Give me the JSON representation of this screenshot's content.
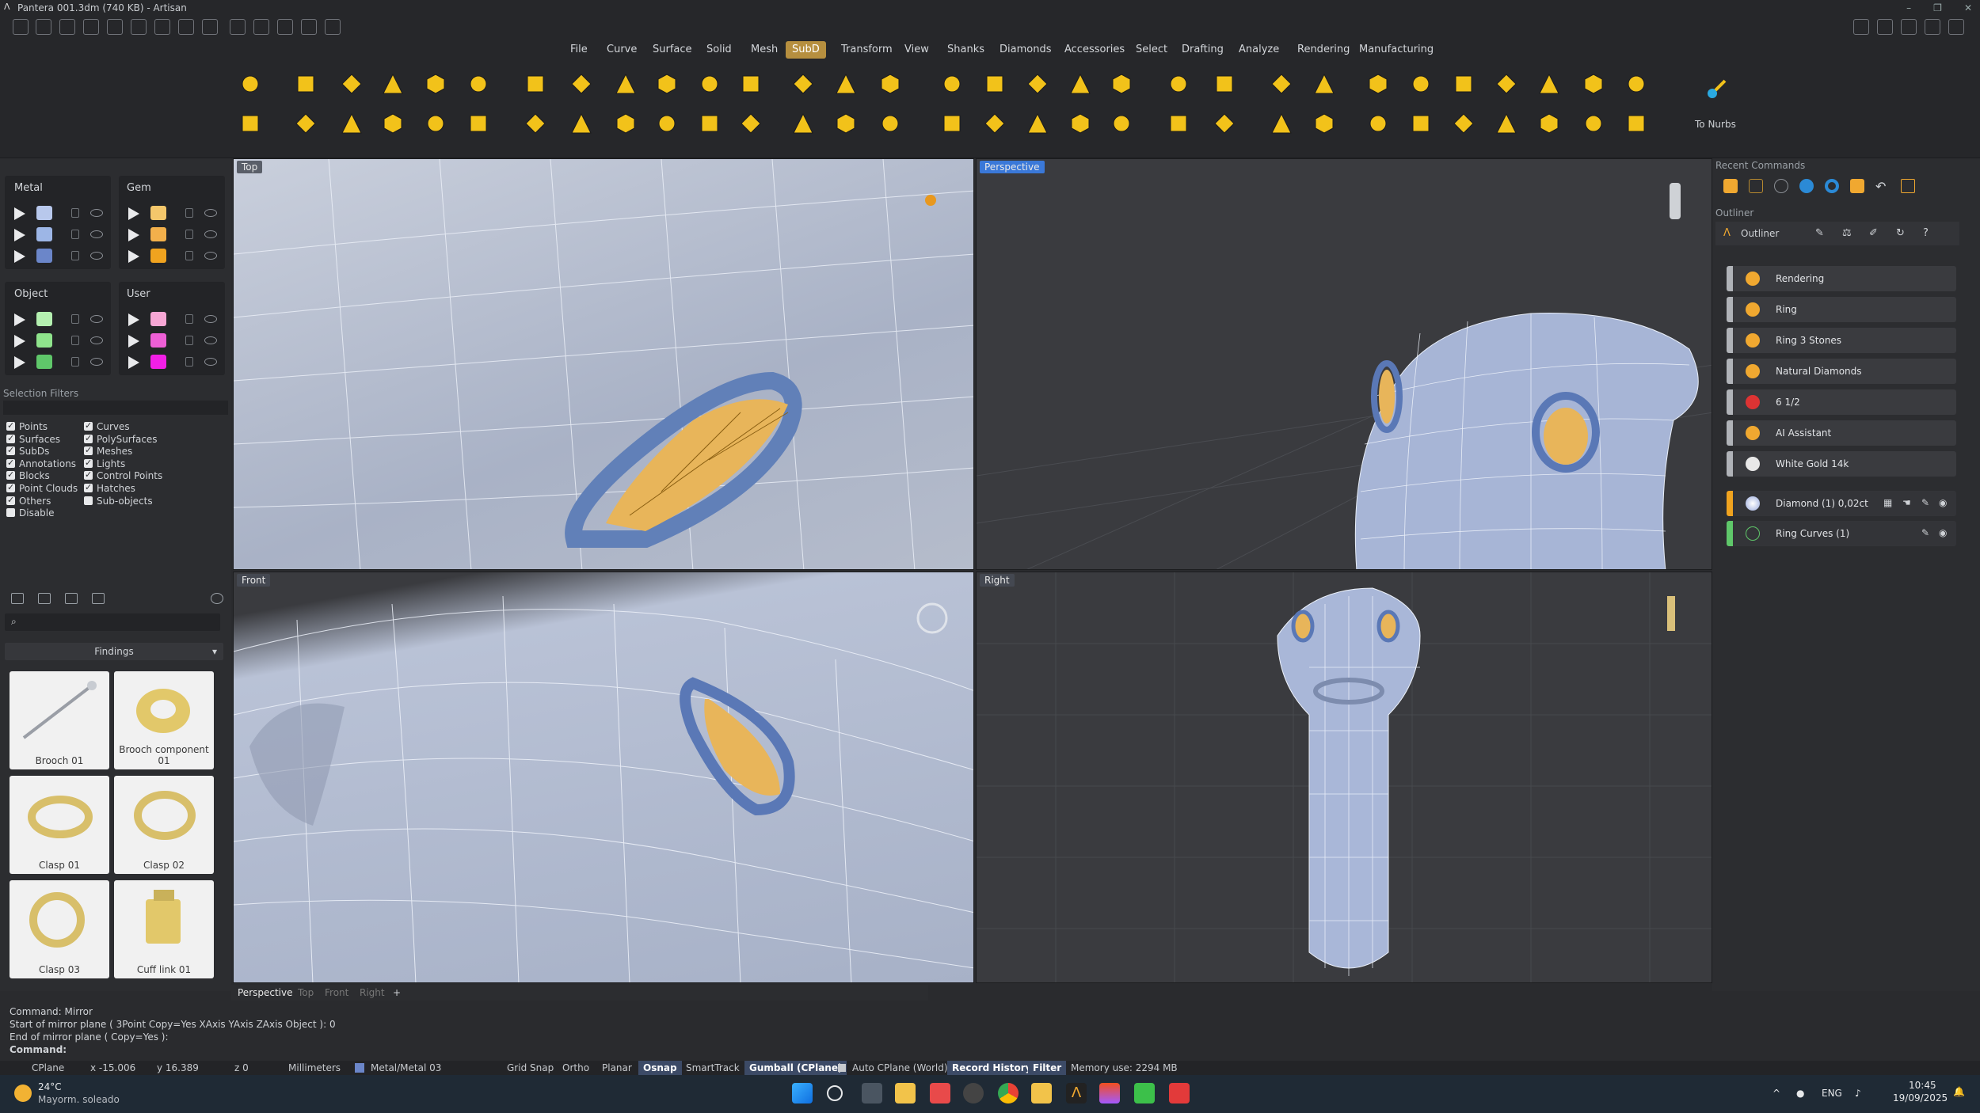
{
  "window": {
    "title": "Pantera 001.3dm (740 KB) - Artisan",
    "controls": [
      "–",
      "❐",
      "✕"
    ]
  },
  "menu": {
    "items": [
      "File",
      "Curve",
      "Surface",
      "Solid",
      "Mesh",
      "SubD",
      "Transform",
      "View",
      "Shanks",
      "Diamonds",
      "Accessories",
      "Select",
      "Drafting",
      "Analyze",
      "Rendering",
      "Manufacturing"
    ],
    "active": "SubD"
  },
  "ribbon": {
    "to_nurbs": "To Nurbs"
  },
  "layers": {
    "metal": {
      "title": "Metal",
      "colors": [
        "#b8c8ec",
        "#9db6e6",
        "#6b86c9"
      ]
    },
    "gem": {
      "title": "Gem",
      "colors": [
        "#f4c76b",
        "#f3b04b",
        "#f0a31f"
      ]
    },
    "object": {
      "title": "Object",
      "colors": [
        "#b4f0b0",
        "#8fe48c",
        "#5fc76a"
      ]
    },
    "user": {
      "title": "User",
      "colors": [
        "#f6a6d4",
        "#ee5fd6",
        "#f21fe6"
      ]
    }
  },
  "selection_filters": {
    "title": "Selection Filters",
    "left": [
      "Points",
      "Surfaces",
      "SubDs",
      "Annotations",
      "Blocks",
      "Point Clouds",
      "Others",
      "Disable"
    ],
    "right": [
      "Curves",
      "PolySurfaces",
      "Meshes",
      "Lights",
      "Control Points",
      "Hatches",
      "Sub-objects"
    ],
    "checked_left": [
      true,
      true,
      true,
      true,
      true,
      true,
      true,
      false
    ],
    "checked_right": [
      true,
      true,
      true,
      true,
      true,
      true,
      false
    ]
  },
  "library": {
    "search_placeholder": "",
    "category": "Findings",
    "items": [
      "Brooch 01",
      "Brooch component 01",
      "Clasp 01",
      "Clasp 02",
      "Clasp 03",
      "Cuff link 01"
    ]
  },
  "viewports": {
    "top": "Top",
    "perspective": "Perspective",
    "front": "Front",
    "right": "Right"
  },
  "viewport_tabs": [
    "Perspective",
    "Top",
    "Front",
    "Right",
    "+"
  ],
  "recent_commands": {
    "title": "Recent Commands"
  },
  "outliner": {
    "title": "Outliner",
    "header": "Outliner",
    "rows": [
      {
        "label": "Rendering",
        "color": "#b0b3b8",
        "icon_color": "#f0a830"
      },
      {
        "label": "Ring",
        "color": "#b0b3b8",
        "icon_color": "#f0a830"
      },
      {
        "label": "Ring 3 Stones",
        "color": "#b0b3b8",
        "icon_color": "#f0a830"
      },
      {
        "label": "Natural Diamonds",
        "color": "#b0b3b8",
        "icon_color": "#f0a830"
      },
      {
        "label": "6 1/2",
        "color": "#b0b3b8",
        "icon_color": "#d33"
      },
      {
        "label": "AI Assistant",
        "color": "#b0b3b8",
        "icon_color": "#f0a830"
      },
      {
        "label": "White Gold 14k",
        "color": "#b0b3b8",
        "icon_color": "#e8e8e8"
      }
    ],
    "objects": [
      {
        "label": "Diamond (1) 0,02ct",
        "color": "#f0a31f"
      },
      {
        "label": "Ring Curves (1)",
        "color": "#5fc76a"
      }
    ]
  },
  "command_history": [
    "Command: Mirror",
    "Start of mirror plane ( 3Point  Copy=Yes  XAxis  YAxis  ZAxis  Object ): 0",
    "End of mirror plane ( Copy=Yes ):"
  ],
  "command_prompt": "Command:",
  "status": {
    "cplane": "CPlane",
    "x": "x -15.006",
    "y": "y 16.389",
    "z": "z 0",
    "units": "Millimeters",
    "layer": "Metal/Metal 03",
    "grid_snap": "Grid Snap",
    "ortho": "Ortho",
    "planar": "Planar",
    "osnap": "Osnap",
    "smarttrack": "SmartTrack",
    "gumball": "Gumball (CPlane)",
    "auto_cplane": "Auto CPlane (World)",
    "record_history": "Record History",
    "filter": "Filter",
    "memory": "Memory use: 2294 MB"
  },
  "taskbar": {
    "temp": "24°C",
    "weather": "Mayorm. soleado",
    "lang": "ENG",
    "time": "10:45",
    "date": "19/09/2025"
  }
}
